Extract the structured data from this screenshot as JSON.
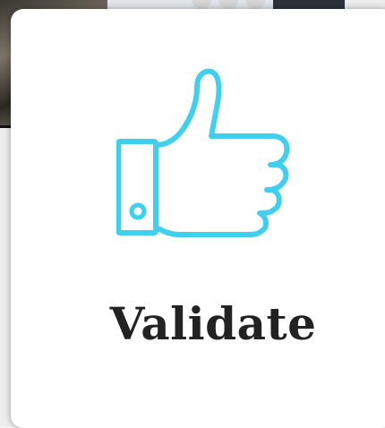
{
  "card": {
    "label": "Validate",
    "icon": "thumbs-up-icon",
    "icon_color": "#3fd0f0",
    "text_color": "#222222"
  }
}
